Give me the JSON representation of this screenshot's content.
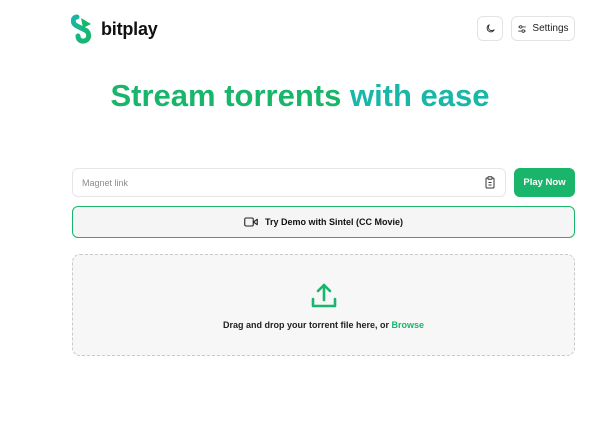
{
  "app": {
    "name": "bitplay"
  },
  "header": {
    "settings_label": "Settings"
  },
  "hero": {
    "title_part1": "Stream torrents ",
    "title_part2": "with ease"
  },
  "magnet": {
    "placeholder": "Magnet link",
    "value": ""
  },
  "play_button": {
    "label": "Play Now"
  },
  "demo_button": {
    "label": "Try Demo with Sintel (CC Movie)"
  },
  "dropzone": {
    "text": "Drag and drop your torrent file here, or ",
    "browse_label": "Browse"
  },
  "icons": {
    "logo": "bitplay-logo-icon",
    "theme": "moon-icon",
    "settings": "sliders-icon",
    "paste": "clipboard-icon",
    "demo": "video-camera-icon",
    "upload": "upload-icon"
  },
  "colors": {
    "primary": "#19b56b",
    "accent": "#19b7a8"
  }
}
